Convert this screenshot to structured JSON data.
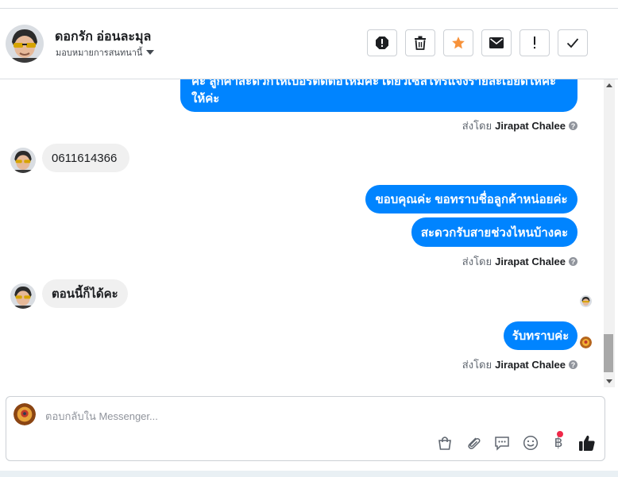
{
  "header": {
    "name": "ดอกรัก อ่อนละมุล",
    "assign_label": "มอบหมายการสนทนานี้",
    "buttons": [
      "spam",
      "delete",
      "star",
      "mark-unread",
      "important",
      "done"
    ]
  },
  "messages": {
    "partial_outgoing": {
      "line1": "ค่ะ ลูกค้าสะดวกให้เบอร์ติดต่อไหมคะ เดี๋ยวเซลโทรแจ้งรายละเอียดให้ค่ะ",
      "line2": "ให้ค่ะ"
    },
    "sent_by_prefix": "ส่งโดย",
    "agent_name": "Jirapat Chalee",
    "incoming_phone": "0611614366",
    "out_thanks": "ขอบคุณค่ะ ขอทราบชื่อลูกค้าหน่อยค่ะ",
    "out_time": "สะดวกรับสายช่วงไหนบ้างคะ",
    "incoming_now": "ตอนนี้ก็ได้คะ",
    "out_ack": "รับทราบค่ะ"
  },
  "composer": {
    "placeholder": "ตอบกลับใน Messenger...",
    "baht_symbol": "฿"
  },
  "colors": {
    "outgoing_bubble": "#0084ff",
    "incoming_bubble": "#f0f0f0",
    "star": "#f7923a",
    "notification_dot": "#f02849"
  }
}
